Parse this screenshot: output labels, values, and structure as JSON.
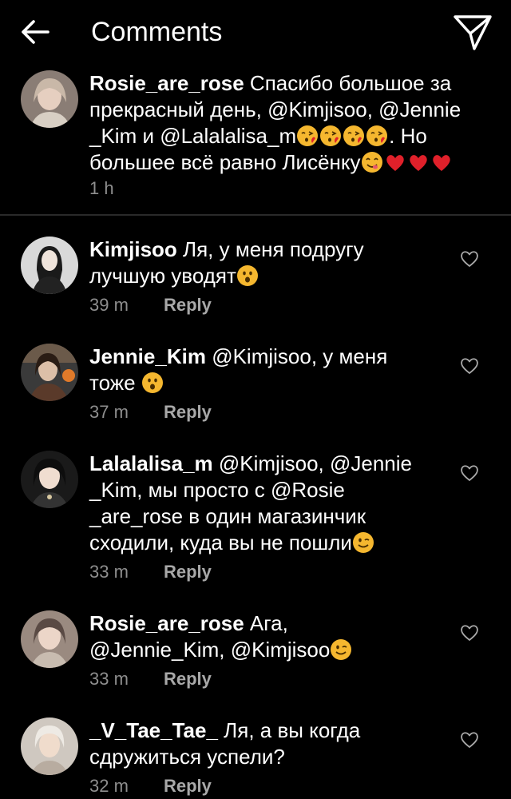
{
  "header": {
    "title": "Comments"
  },
  "caption": {
    "username": "Rosie_are_rose",
    "text_1": "Спасибо большое за прекрасный день, @Kimjisoo, @Jennie _Kim и @Lalalalisa_m",
    "text_2": ". Но большее всё равно Лисёнку",
    "time": "1 h"
  },
  "comments": [
    {
      "username": "Kimjisoo",
      "text": "Ля, у меня подругу лучшую уводят",
      "time": "39 m",
      "reply": "Reply"
    },
    {
      "username": "Jennie_Kim",
      "text": "@Kimjisoo, у меня тоже",
      "time": "37 m",
      "reply": "Reply"
    },
    {
      "username": "Lalalalisa_m",
      "text": "@Kimjisoo, @Jennie _Kim, мы просто с @Rosie _are_rose в один магазинчик сходили, куда вы не пошли",
      "time": "33 m",
      "reply": "Reply"
    },
    {
      "username": "Rosie_are_rose",
      "text": "Ага, @Jennie_Kim, @Kimjisoo",
      "time": "33 m",
      "reply": "Reply"
    },
    {
      "username": "_V_Tae_Tae_",
      "text": "Ля, а вы когда сдружиться успели?",
      "time": "32 m",
      "reply": "Reply"
    }
  ],
  "icons": {
    "back": "arrow-left-icon",
    "send": "paper-plane-icon",
    "like": "heart-outline-icon",
    "kiss": "face-blowing-kiss-emoji",
    "yum": "face-savoring-food-emoji",
    "heart_red": "red-heart-emoji",
    "surprised": "hushed-face-emoji",
    "wink": "winking-face-emoji"
  },
  "colors": {
    "background": "#000000",
    "text": "#ffffff",
    "meta": "#8e8e8e",
    "divider": "#2a2a2a",
    "emoji_yellow": "#f5b72f",
    "emoji_heart": "#e0202a"
  }
}
